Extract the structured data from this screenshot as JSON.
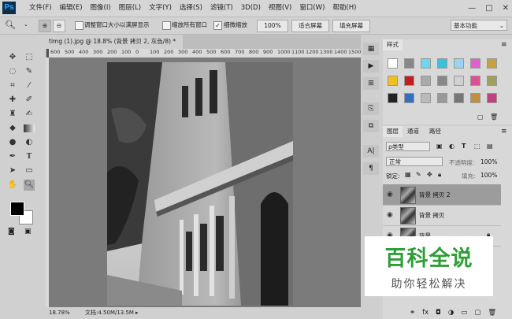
{
  "app": {
    "logo": "Ps"
  },
  "menu": [
    "文件(F)",
    "编辑(E)",
    "图像(I)",
    "图层(L)",
    "文字(Y)",
    "选择(S)",
    "滤镜(T)",
    "3D(D)",
    "视图(V)",
    "窗口(W)",
    "帮助(H)"
  ],
  "window_controls": [
    "—",
    "□",
    "✕"
  ],
  "options": {
    "resize_windows": "调整窗口大小以满屏显示",
    "zoom_all": "缩放所有窗口",
    "scrubby_zoom": "细微缩放",
    "zoom_100": "100%",
    "fit_screen": "适合屏幕",
    "fill_screen": "填充屏幕",
    "workspace": "基本功能"
  },
  "document": {
    "tab_title": "timg (1).jpg @ 18.8% (背景 拷贝 2, 灰色/8) *",
    "ruler_labels": [
      "600",
      "500",
      "400",
      "300",
      "200",
      "100",
      "0",
      "100",
      "200",
      "300",
      "400",
      "500",
      "600",
      "700",
      "800",
      "900",
      "1000",
      "1100",
      "1200",
      "1300",
      "1400",
      "1500"
    ],
    "zoom": "18.78%",
    "doc_info": "文档:4.50M/13.5M"
  },
  "styles_panel": {
    "tab": "样式"
  },
  "layers_panel": {
    "tabs": [
      "图层",
      "通道",
      "路径"
    ],
    "filter_kind": "ρ类型",
    "blend_mode": "正常",
    "opacity_label": "不透明度:",
    "opacity_value": "100%",
    "lock_label": "锁定:",
    "fill_label": "填充:",
    "fill_value": "100%",
    "layers": [
      "背景 拷贝 2",
      "背景 拷贝",
      "背景"
    ]
  },
  "watermark": {
    "title": "百科全说",
    "subtitle": "助你轻松解决"
  },
  "colors": {
    "accent_green": "#2e9e37",
    "panel_bg": "#d0d0d0",
    "canvas_bg": "#7b7b7b"
  }
}
